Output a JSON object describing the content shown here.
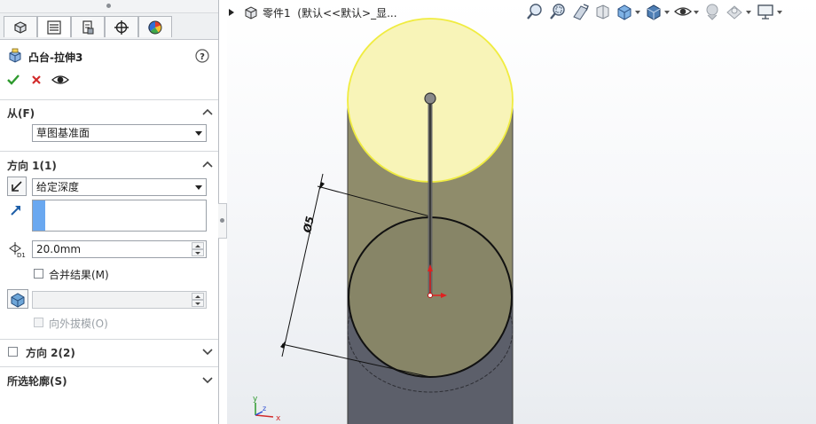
{
  "panel": {
    "tabs": [
      {
        "name": "featuremanager",
        "active": false
      },
      {
        "name": "propertymanager",
        "active": true
      },
      {
        "name": "configurationmanager",
        "active": false
      },
      {
        "name": "dimxpertmanager",
        "active": false
      },
      {
        "name": "displaymanager",
        "active": false
      }
    ],
    "feature_title": "凸台-拉伸3",
    "help_icon": "help-icon",
    "actions": [
      "ok-check-icon",
      "cancel-x-icon",
      "preview-eye-icon"
    ],
    "from": {
      "header": "从(F)",
      "start_condition": "草图基准面"
    },
    "direction1": {
      "header": "方向 1(1)",
      "end_condition": "给定深度",
      "depth_value": "20.0mm",
      "depth_icon_label": "D1",
      "merge_result_label": "合并结果(M)",
      "merge_result_checked": false,
      "draft_value": "",
      "draft_outward_label": "向外拔模(O)",
      "draft_outward_checked": false
    },
    "direction2": {
      "header": "方向 2(2)",
      "checked": false
    },
    "selected_contours": {
      "header": "所选轮廓(S)"
    }
  },
  "viewport": {
    "breadcrumb": "零件1  (默认<<默认>_显...",
    "dimension_label": "Ø5",
    "triad": {
      "x": "x",
      "y": "y",
      "z": "z"
    },
    "toolbar_icons": [
      "zoom-to-fit-icon",
      "zoom-to-area-icon",
      "previous-view-icon",
      "section-view-icon",
      "view-orientation-icon",
      "display-style-icon",
      "hide-show-items-icon",
      "edit-appearance-icon",
      "apply-scene-icon",
      "view-settings-icon"
    ],
    "colors": {
      "cylinder_top": "#f7f3b4",
      "cylinder_body": "#7f7d62",
      "sketch_fill": "#868466",
      "preview_edge": "#f0ec40"
    }
  }
}
